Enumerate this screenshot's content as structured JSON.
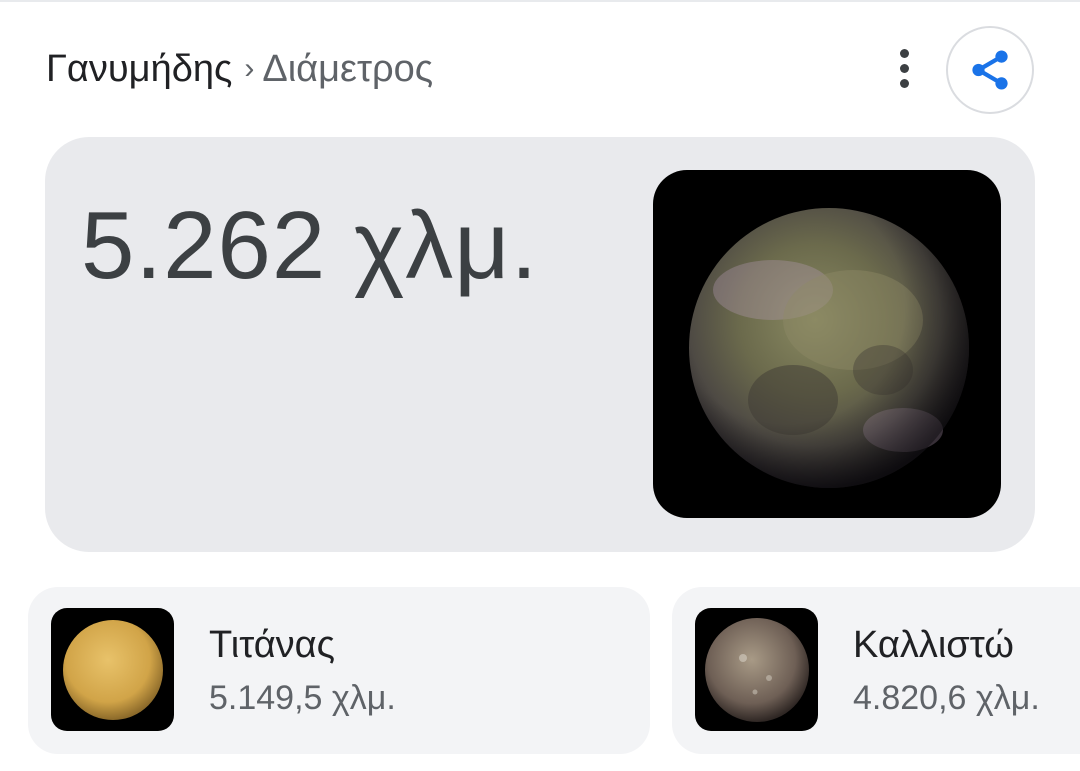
{
  "breadcrumb": {
    "parent": "Γανυμήδης",
    "separator": "›",
    "current": "Διάμετρος"
  },
  "actions": {
    "more_icon": "more-vert-icon",
    "share_icon": "share-icon",
    "share_color": "#1a73e8"
  },
  "answer": {
    "value": "5.262 χλμ.",
    "image": "ganymede-image"
  },
  "related": [
    {
      "name": "Τιτάνας",
      "value": "5.149,5 χλμ.",
      "image": "titan-image"
    },
    {
      "name": "Καλλιστώ",
      "value": "4.820,6 χλμ.",
      "image": "callisto-image"
    }
  ]
}
